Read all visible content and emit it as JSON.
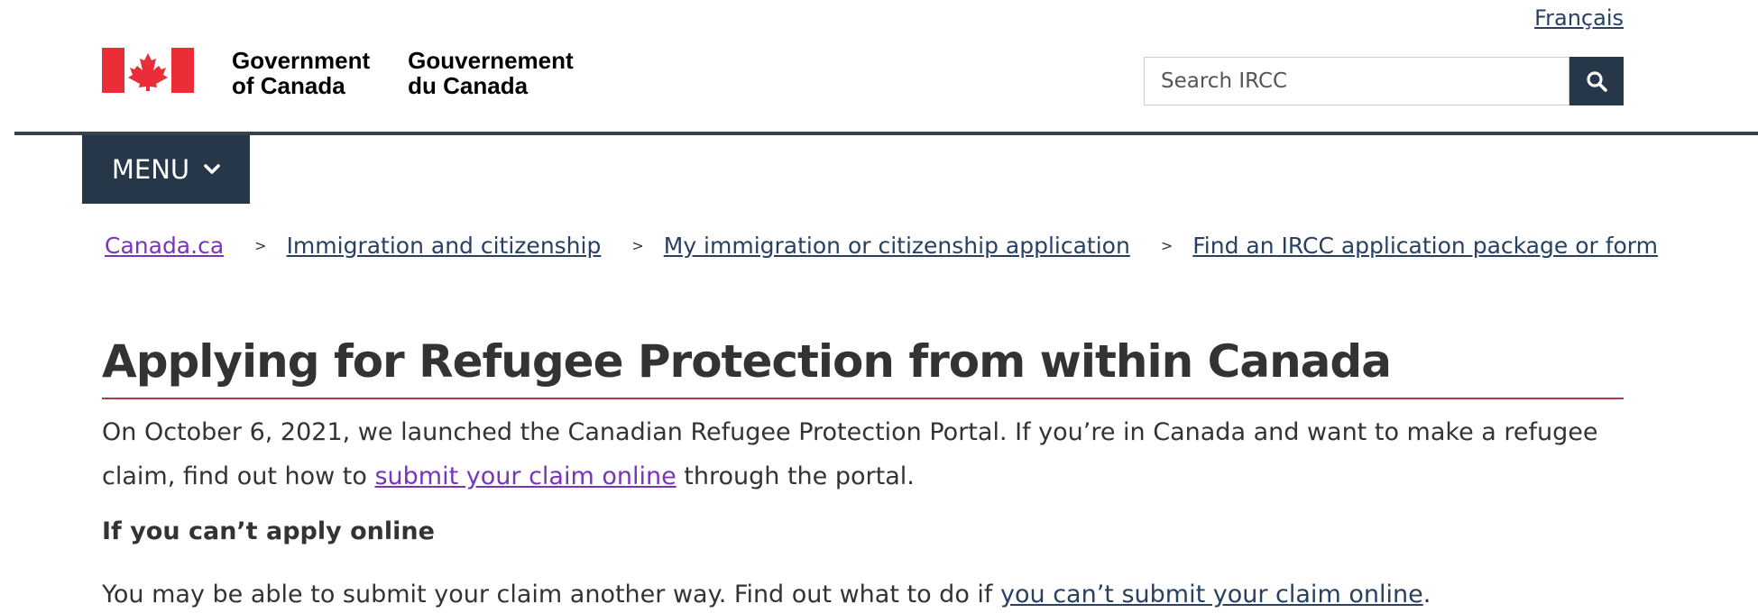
{
  "header": {
    "language_link": "Français",
    "gov_en_line1": "Government",
    "gov_en_line2": "of Canada",
    "gov_fr_line1": "Gouvernement",
    "gov_fr_line2": "du Canada",
    "search_placeholder": "Search IRCC",
    "search_button_icon": "search-icon"
  },
  "nav": {
    "menu_label": "MENU",
    "menu_icon": "chevron-down-icon"
  },
  "breadcrumb": {
    "items": [
      {
        "label": "Canada.ca",
        "visited": true
      },
      {
        "label": "Immigration and citizenship"
      },
      {
        "label": "My immigration or citizenship application"
      },
      {
        "label": "Find an IRCC application package or form"
      }
    ],
    "separator": ">"
  },
  "main": {
    "title": "Applying for Refugee Protection from within Canada",
    "intro_before": "On October 6, 2021, we launched the Canadian Refugee Protection Portal. If you’re in Canada and want to make a refugee claim, find out how to ",
    "intro_link": "submit your claim online",
    "intro_after": " through the portal.",
    "subheading": "If you can’t apply online",
    "para2_before": "You may be able to submit your claim another way. Find out what to do if ",
    "para2_link": "you can’t submit your claim online",
    "para2_after": "."
  },
  "colors": {
    "flag_red": "#eb2d37",
    "nav_bg": "#26374a",
    "link": "#284162",
    "visited_link": "#7834bc",
    "title_rule": "#af3c43"
  }
}
